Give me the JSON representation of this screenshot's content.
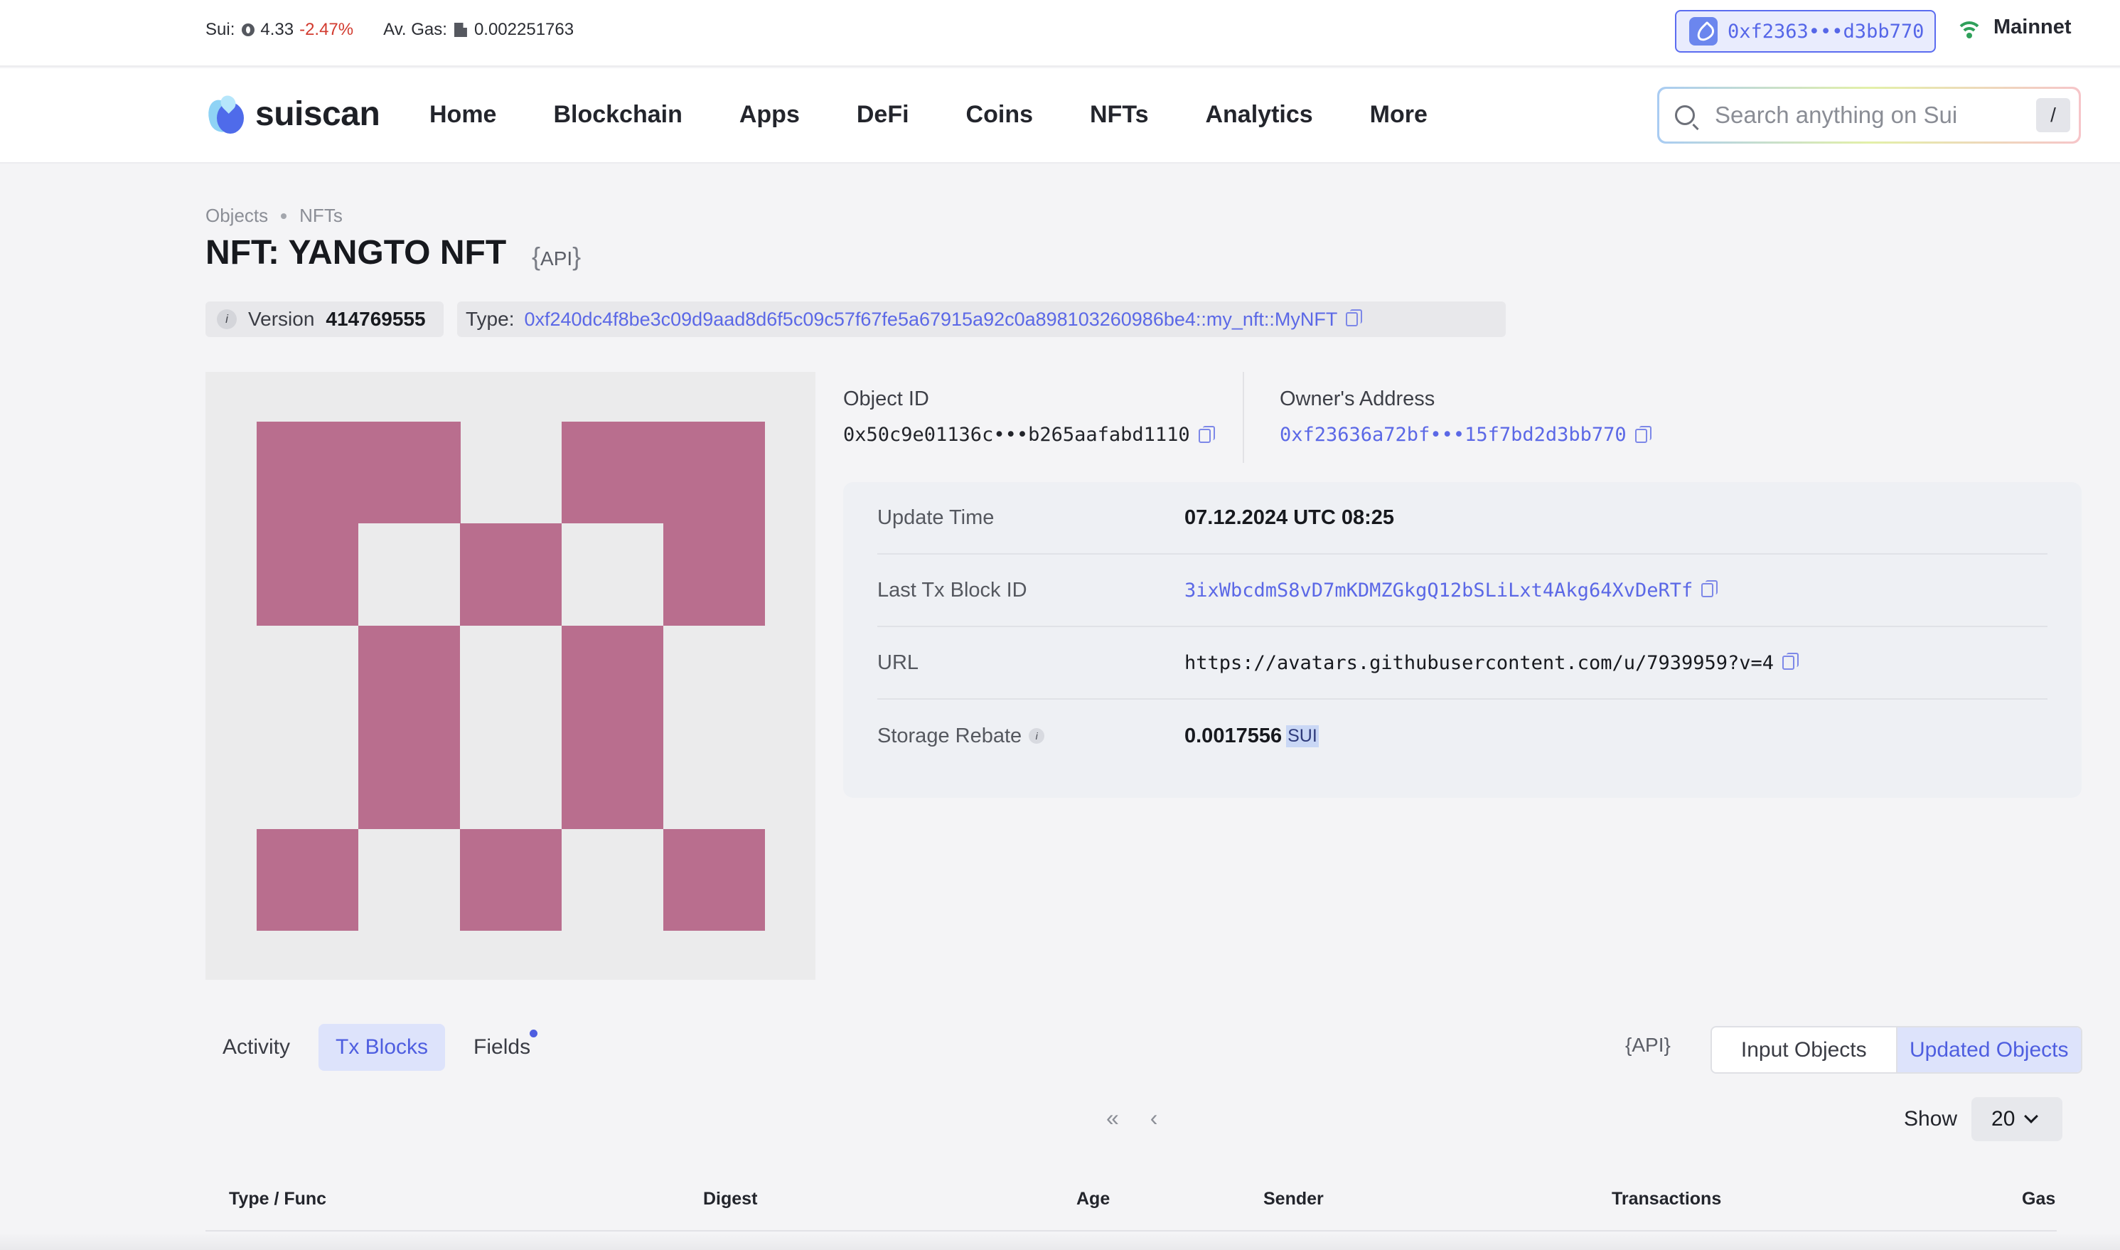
{
  "ticker": {
    "sui_label": "Sui:",
    "sui_price": "4.33",
    "sui_change": "-2.47%",
    "gas_label": "Av. Gas:",
    "gas_value": "0.002251763"
  },
  "wallet": {
    "address": "0xf2363•••d3bb770"
  },
  "network": {
    "label": "Mainnet"
  },
  "brand": {
    "name": "suiscan"
  },
  "nav": [
    "Home",
    "Blockchain",
    "Apps",
    "DeFi",
    "Coins",
    "NFTs",
    "Analytics",
    "More"
  ],
  "search": {
    "placeholder": "Search anything on Sui",
    "shortcut": "/"
  },
  "breadcrumb": [
    "Objects",
    "NFTs"
  ],
  "page": {
    "title": "NFT: YANGTO NFT",
    "api_label": "API"
  },
  "meta": {
    "version_label": "Version",
    "version_value": "414769555",
    "type_label": "Type:",
    "type_value": "0xf240dc4f8be3c09d9aad8d6f5c09c57f67fe5a67915a92c0a898103260986be4::my_nft::MyNFT"
  },
  "object": {
    "id_label": "Object ID",
    "id_value": "0x50c9e01136c•••b265aafabd1110",
    "owner_label": "Owner's Address",
    "owner_value": "0xf23636a72bf•••15f7bd2d3bb770"
  },
  "details": {
    "update_time_label": "Update Time",
    "update_time_value": "07.12.2024 UTC 08:25",
    "last_tx_label": "Last Tx Block ID",
    "last_tx_value": "3ixWbcdmS8vD7mKDMZGkgQ12bSLiLxt4Akg64XvDeRTf",
    "url_label": "URL",
    "url_value": "https://avatars.githubusercontent.com/u/7939959?v=4",
    "rebate_label": "Storage Rebate",
    "rebate_value": "0.0017556",
    "rebate_unit": "SUI"
  },
  "tabs": [
    "Activity",
    "Tx Blocks",
    "Fields"
  ],
  "segments": [
    "Input Objects",
    "Updated Objects"
  ],
  "pager": {
    "first": "«",
    "prev": "‹"
  },
  "show": {
    "label": "Show",
    "value": "20"
  },
  "table": {
    "headers": [
      "Type / Func",
      "Digest",
      "Age",
      "Sender",
      "Transactions",
      "Gas"
    ]
  },
  "colors": {
    "accent": "#5b68e6",
    "nft_pink": "#b96e8e",
    "negative": "#d23b2f",
    "online": "#2fa05a"
  }
}
